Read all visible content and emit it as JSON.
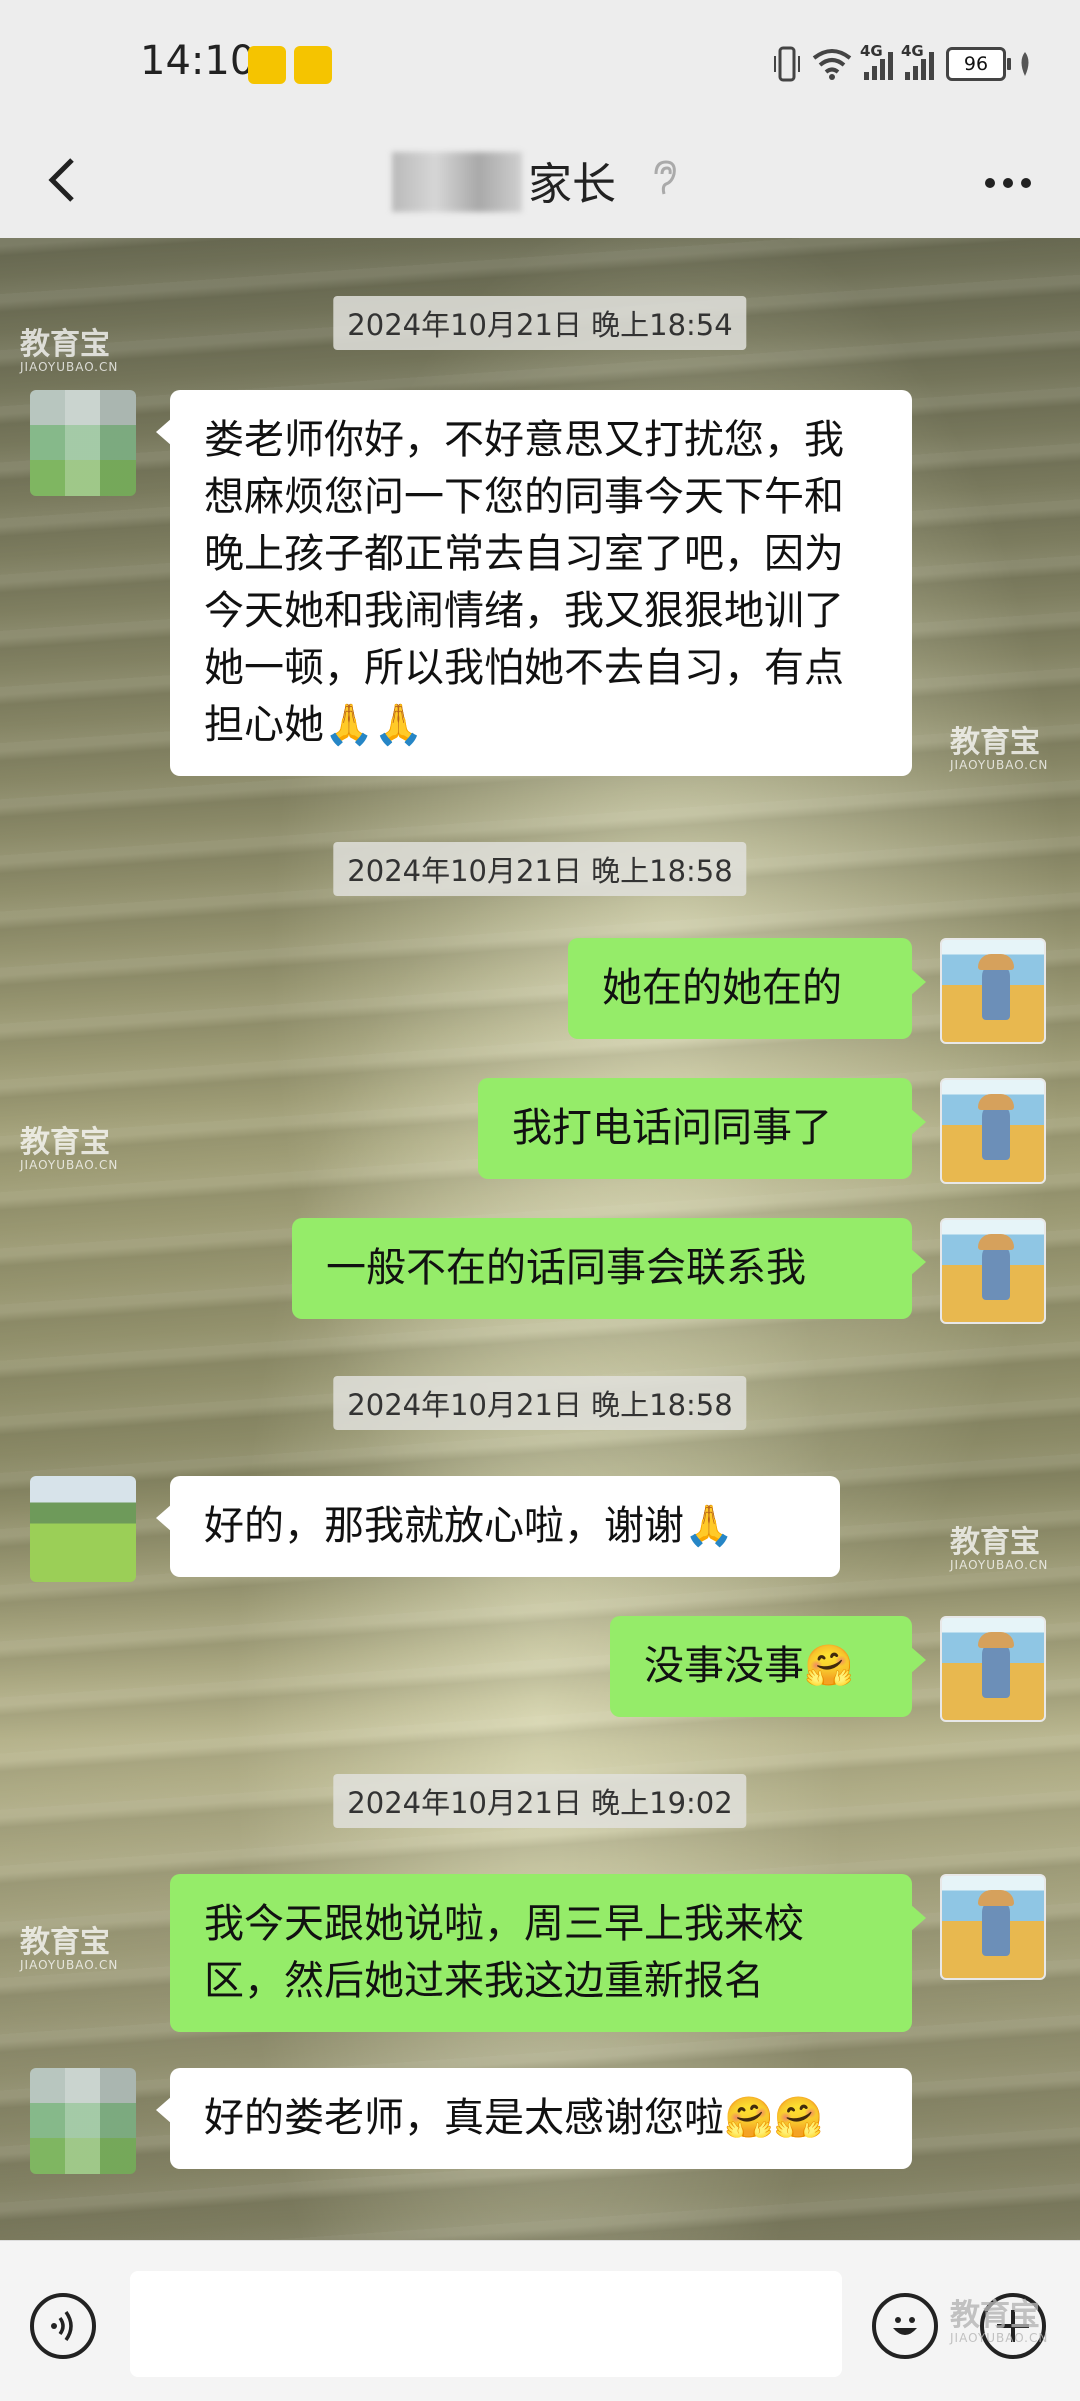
{
  "status_bar": {
    "time": "14:10",
    "signal_label_1": "4G",
    "signal_label_2": "4G",
    "battery": "96"
  },
  "header": {
    "title": "家长",
    "back_icon": "chevron-left-icon",
    "more_icon": "more-icon"
  },
  "messages": [
    {
      "type": "timestamp",
      "text": "2024年10月21日 晚上18:54"
    },
    {
      "type": "incoming",
      "text": "娄老师你好，不好意思又打扰您，我想麻烦您问一下您的同事今天下午和晚上孩子都正常去自习室了吧，因为今天她和我闹情绪，我又狠狠地训了她一顿，所以我怕她不去自习，有点担心她🙏🙏"
    },
    {
      "type": "timestamp",
      "text": "2024年10月21日 晚上18:58"
    },
    {
      "type": "outgoing",
      "text": "她在的她在的"
    },
    {
      "type": "outgoing",
      "text": "我打电话问同事了"
    },
    {
      "type": "outgoing",
      "text": "一般不在的话同事会联系我"
    },
    {
      "type": "timestamp",
      "text": "2024年10月21日 晚上18:58"
    },
    {
      "type": "incoming",
      "text": "好的，那我就放心啦，谢谢🙏"
    },
    {
      "type": "outgoing",
      "text": "没事没事🤗"
    },
    {
      "type": "timestamp",
      "text": "2024年10月21日 晚上19:02"
    },
    {
      "type": "outgoing",
      "text": "我今天跟她说啦，周三早上我来校区，然后她过来我这边重新报名"
    },
    {
      "type": "incoming",
      "text": "好的娄老师，真是太感谢您啦🤗🤗"
    }
  ],
  "watermark": {
    "text": "教育宝",
    "sub": "JIAOYUBAO.CN"
  },
  "input_bar": {
    "voice_icon": "voice-icon",
    "emoji_icon": "emoji-icon",
    "plus_icon": "plus-icon"
  }
}
